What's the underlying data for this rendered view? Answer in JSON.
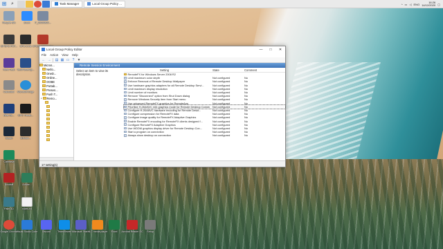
{
  "taskbar": {
    "tasks": [
      {
        "label": "Task Manager"
      },
      {
        "label": "Local Group Policy ..."
      }
    ],
    "tray": {
      "lang": "ENG",
      "time": "16:26",
      "date": "14/12/2020"
    }
  },
  "desktop_icons": [
    {
      "label": "Recycle Bin",
      "color": "#8aa0b8"
    },
    {
      "label": "Zoom",
      "color": "#2d8cff"
    },
    {
      "label": "P_20200802...",
      "color": "#7c8aa0"
    },
    {
      "label": "GPGPU-PCT...",
      "color": "#3a3a3a"
    },
    {
      "label": "GPU-Z.lnk",
      "color": "#2b2b2b"
    },
    {
      "label": "CPUID HWMonitor",
      "color": "#b33a2a"
    },
    {
      "label": "Hiero Tech",
      "color": "#5a3c9a"
    },
    {
      "label": "TechPowerUp...",
      "color": "#2a4f8a"
    },
    {
      "label": "Calculator",
      "color": "#8a8a8a"
    },
    {
      "label": "Microsoft Edge",
      "color": "#2a8fd8"
    },
    {
      "label": "Blue Sc...",
      "color": "#1f3f7a"
    },
    {
      "label": "GPU Tweak...",
      "color": "#1a1a1a"
    },
    {
      "label": "Steam",
      "color": "#1b2838"
    },
    {
      "label": "3DMark...",
      "color": "#2c2c2c"
    },
    {
      "label": "Camtasia",
      "color": "#1b8a5a"
    },
    {
      "label": "Acrobat",
      "color": "#b32222"
    },
    {
      "label": "Adobe...",
      "color": "#2e7d5a"
    },
    {
      "label": "Paint 3D",
      "color": "#3a7a8a"
    },
    {
      "label": "notes.txt",
      "color": "#f2f2f2"
    }
  ],
  "bottom_icons": [
    {
      "label": "Google Chrome",
      "color": "#dd4b39"
    },
    {
      "label": "Visual Studio Code",
      "color": "#2b7bd8"
    },
    {
      "label": "Discord",
      "color": "#5865f2"
    },
    {
      "label": "TeamViewer",
      "color": "#0e8ee9"
    },
    {
      "label": "Microsoft Teams",
      "color": "#5b5fc7"
    },
    {
      "label": "VLC media player",
      "color": "#f08a1e"
    },
    {
      "label": "Excel",
      "color": "#1f7a46"
    },
    {
      "label": "Acrobat Reader DC",
      "color": "#c62828"
    },
    {
      "label": "Setup",
      "color": "#7a7a7a"
    }
  ],
  "window": {
    "title": "Local Group Policy Editor",
    "menu": [
      "File",
      "Action",
      "View",
      "Help"
    ],
    "tree": [
      "Micros...",
      "Netlo...",
      "OneD...",
      "Online...",
      "OOBE",
      "Portab...",
      "Presen...",
      "Push T...",
      "Remo...",
      "",
      "",
      "",
      "",
      "",
      "",
      "",
      "",
      "",
      "",
      ""
    ],
    "header_band": "Remote Session Environment",
    "description_prompt": "Select an item to view its description.",
    "columns": {
      "setting": "Setting",
      "state": "State",
      "comment": "Comment"
    },
    "rows": [
      {
        "name": "RemoteFX for Windows Server 2008 R2",
        "state": "",
        "comment": ""
      },
      {
        "name": "Limit maximum color depth",
        "state": "Not configured",
        "comment": "No"
      },
      {
        "name": "Enforce Removal of Remote Desktop Wallpaper",
        "state": "Not configured",
        "comment": "No"
      },
      {
        "name": "Use hardware graphics adapters for all Remote Desktop Servi...",
        "state": "Not configured",
        "comment": "No"
      },
      {
        "name": "Limit maximum display resolution",
        "state": "Not configured",
        "comment": "No"
      },
      {
        "name": "Limit number of monitors",
        "state": "Not configured",
        "comment": "No"
      },
      {
        "name": "Remove \"Disconnect\" option from Shut Down dialog",
        "state": "Not configured",
        "comment": "No"
      },
      {
        "name": "Remove Windows Security item from Start menu",
        "state": "Not configured",
        "comment": "No"
      },
      {
        "name": "Use advanced RemoteFX graphics for RemoteApp",
        "state": "Not configured",
        "comment": "No"
      },
      {
        "name": "Prioritize H.264/AVC 444 graphics mode for Remote Desktop Connections",
        "state": "Not configured",
        "comment": "No",
        "selected": true
      },
      {
        "name": "Configure H.264/AVC hardware encoding for Remote Deskt...",
        "state": "Not configured",
        "comment": "No"
      },
      {
        "name": "Configure compression for RemoteFX data",
        "state": "Not configured",
        "comment": "No"
      },
      {
        "name": "Configure image quality for RemoteFX Adaptive Graphics",
        "state": "Not configured",
        "comment": "No"
      },
      {
        "name": "Enable RemoteFX encoding for RemoteFX clients designed f...",
        "state": "Not configured",
        "comment": "No"
      },
      {
        "name": "Configure RemoteFX Adaptive Graphics",
        "state": "Not configured",
        "comment": "No"
      },
      {
        "name": "Use WDDM graphics display driver for Remote Desktop Con...",
        "state": "Not configured",
        "comment": "No"
      },
      {
        "name": "Start a program on connection",
        "state": "Not configured",
        "comment": "No"
      },
      {
        "name": "Always show desktop on connection",
        "state": "Not configured",
        "comment": "No"
      }
    ],
    "tabs": [
      "Extended",
      "Standard"
    ],
    "status": "17 setting(s)"
  }
}
